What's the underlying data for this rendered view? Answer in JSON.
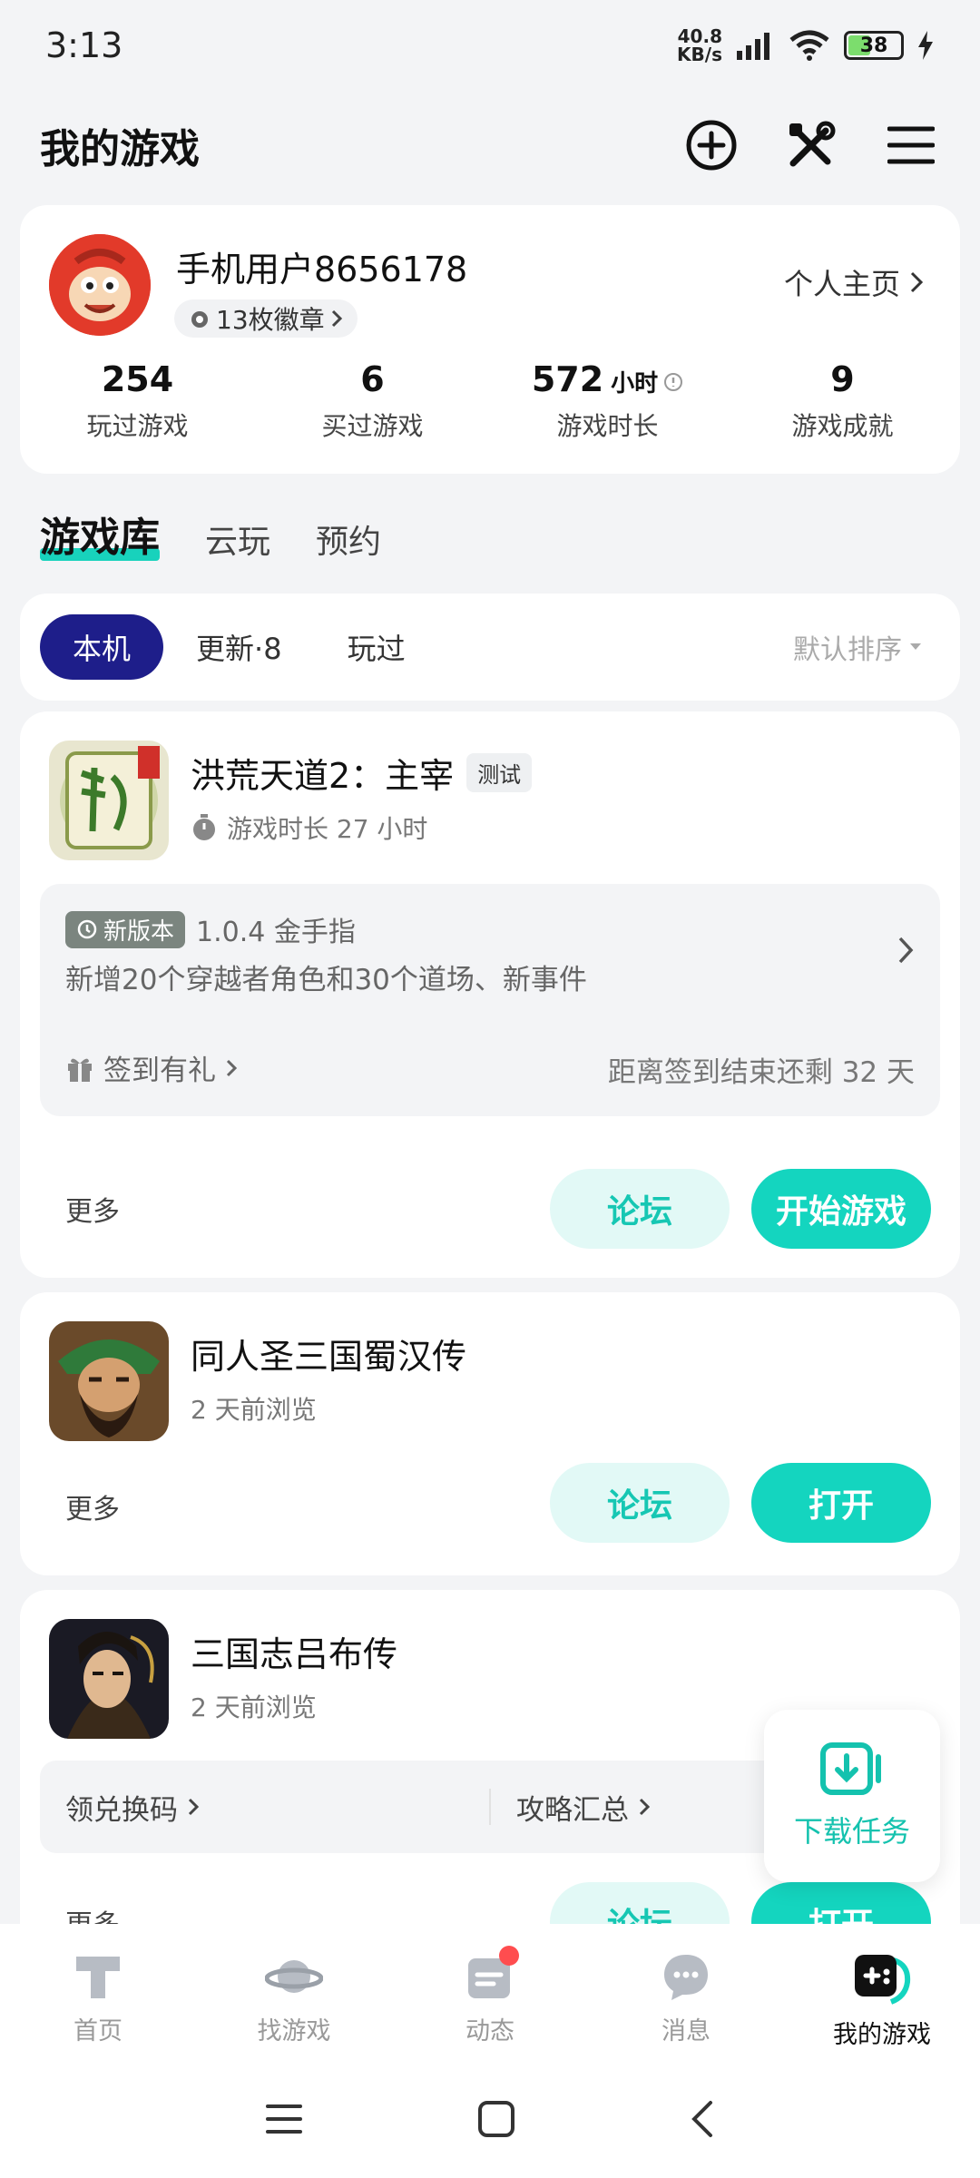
{
  "status": {
    "time": "3:13",
    "net_top": "40.8",
    "net_bottom": "KB/s",
    "battery": "38"
  },
  "header": {
    "title": "我的游戏"
  },
  "profile": {
    "name": "手机用户8656178",
    "badges": "13枚徽章",
    "homepage": "个人主页",
    "stats": [
      {
        "value": "254",
        "label": "玩过游戏"
      },
      {
        "value": "6",
        "label": "买过游戏"
      },
      {
        "value": "572",
        "unit": "小时",
        "label": "游戏时长"
      },
      {
        "value": "9",
        "label": "游戏成就"
      }
    ]
  },
  "tabs": [
    "游戏库",
    "云玩",
    "预约"
  ],
  "filters": {
    "chips": [
      "本机",
      "更新·8",
      "玩过"
    ],
    "sort": "默认排序"
  },
  "games": [
    {
      "title": "洪荒天道2：主宰",
      "tag": "测试",
      "sub": "游戏时长 27 小时",
      "update_tag": "新版本",
      "update_version": "1.0.4 金手指",
      "update_desc": "新增20个穿越者角色和30个道场、新事件",
      "signin": "签到有礼",
      "signin_end": "距离签到结束还剩 32 天",
      "more": "更多",
      "forum": "论坛",
      "action": "开始游戏"
    },
    {
      "title": "同人圣三国蜀汉传",
      "sub": "2 天前浏览",
      "more": "更多",
      "forum": "论坛",
      "action": "打开"
    },
    {
      "title": "三国志吕布传",
      "sub": "2 天前浏览",
      "link1": "领兑换码",
      "link2": "攻略汇总",
      "more": "更多",
      "forum": "论坛",
      "action": "打开"
    }
  ],
  "fab": {
    "label": "下载任务"
  },
  "nav": [
    "首页",
    "找游戏",
    "动态",
    "消息",
    "我的游戏"
  ],
  "colors": {
    "accent": "#14d5bf",
    "active_chip": "#1e1e8a",
    "badge_dot": "#ff4d4f"
  }
}
